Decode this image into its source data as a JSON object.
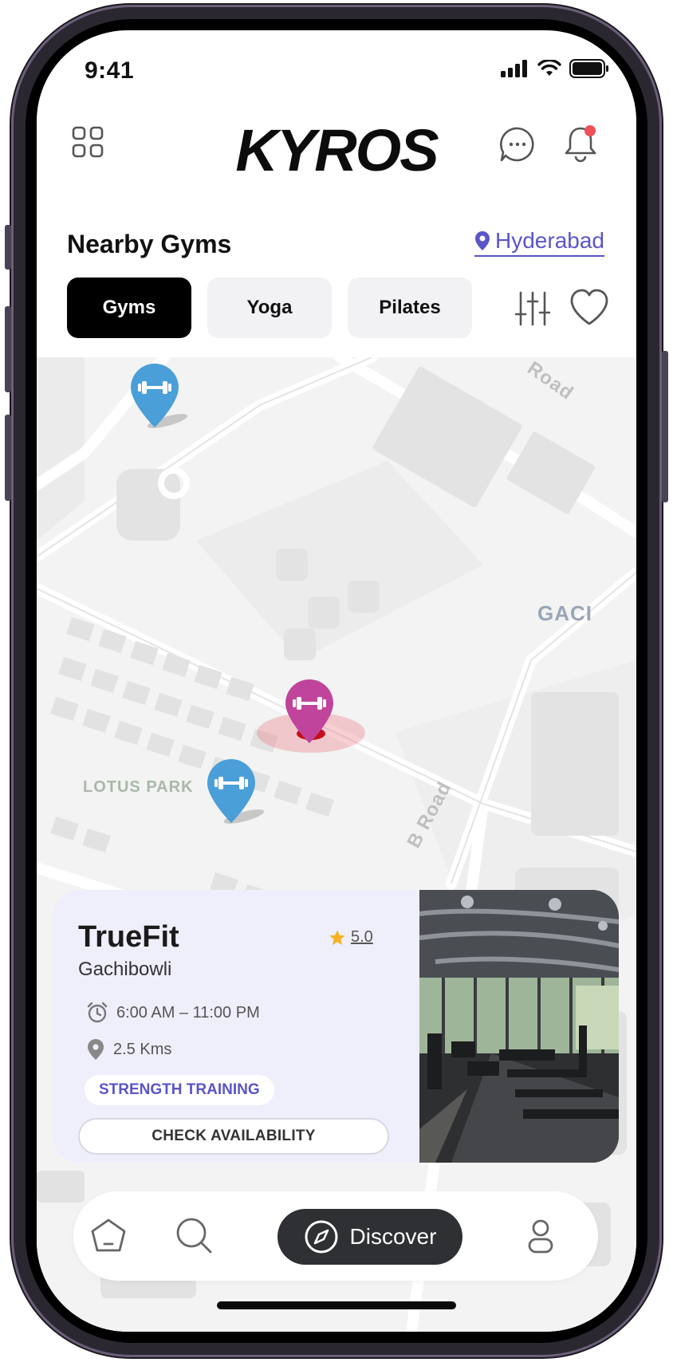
{
  "status_bar": {
    "time": "9:41"
  },
  "header": {
    "logo": "KYROS",
    "menu_icon": "grid-icon",
    "chat_icon": "chat-bubble-icon",
    "notification_icon": "bell-icon"
  },
  "section": {
    "title": "Nearby Gyms",
    "location": "Hyderabad"
  },
  "chips": [
    {
      "label": "Gyms",
      "active": true
    },
    {
      "label": "Yoga",
      "active": false
    },
    {
      "label": "Pilates",
      "active": false
    }
  ],
  "map": {
    "labels": {
      "park": "LOTUS PARK",
      "area": "GACI",
      "road1": "Road",
      "road2": "B Road"
    }
  },
  "gym_card": {
    "name": "TrueFit",
    "area": "Gachibowli",
    "rating": "5.0",
    "hours": "6:00 AM – 11:00 PM",
    "distance": "2.5 Kms",
    "tag": "STRENGTH TRAINING",
    "cta": "CHECK AVAILABILITY"
  },
  "bottom_nav": {
    "discover": "Discover"
  },
  "colors": {
    "accent": "#5a55c8",
    "pin_blue": "#4a9fd8",
    "pin_active": "#c0449b",
    "card_bg": "#efeefb"
  }
}
